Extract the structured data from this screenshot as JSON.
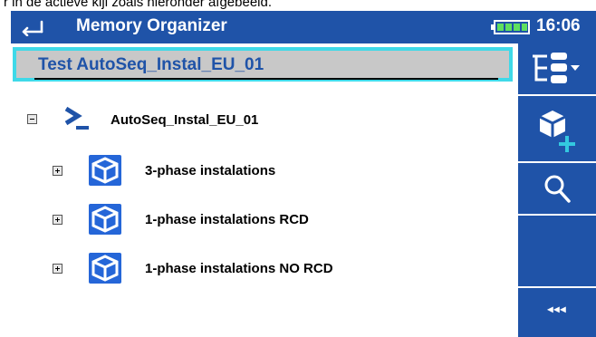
{
  "caption": "r in de actieve kijl zoals hieronder afgebeeld.",
  "header": {
    "title": "Memory Organizer",
    "time": "16:06"
  },
  "selected_item": "Test AutoSeq_Instal_EU_01",
  "tree": {
    "root": {
      "label": "AutoSeq_Instal_EU_01",
      "icon": "auto-sequence-icon",
      "expanded": true
    },
    "children": [
      {
        "label": "3-phase instalations",
        "icon": "cube-icon",
        "expanded": false
      },
      {
        "label": "1-phase instalations RCD",
        "icon": "cube-icon",
        "expanded": false
      },
      {
        "label": "1-phase instalations NO RCD",
        "icon": "cube-icon",
        "expanded": false
      }
    ]
  },
  "sidebar": {
    "buttons": [
      {
        "icon": "tree-view-menu-icon"
      },
      {
        "icon": "add-structure-icon"
      },
      {
        "icon": "search-icon"
      },
      {
        "icon": "empty"
      },
      {
        "icon": "more-icon",
        "label": "◂◂◂"
      }
    ]
  },
  "colors": {
    "bar_blue": "#1f53a8",
    "selection_border": "#3fd9e8",
    "selection_fill": "#c8c8c8",
    "icon_blue": "#2566d8",
    "accent_cyan": "#33c8e0"
  }
}
